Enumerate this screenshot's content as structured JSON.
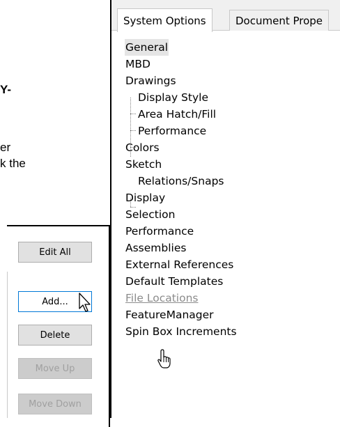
{
  "page_text": {
    "fragment_1": "Y-",
    "fragment_2": "er",
    "fragment_3": "k the"
  },
  "buttons": {
    "edit_all": "Edit All",
    "add": "Add...",
    "delete": "Delete",
    "move_up": "Move Up",
    "move_down": "Move Down"
  },
  "dialog": {
    "tabs": [
      "System Options",
      "Document Prope"
    ],
    "tree": [
      {
        "label": "General",
        "selected": true
      },
      {
        "label": "MBD"
      },
      {
        "label": "Drawings"
      },
      {
        "label": "Display Style",
        "child": true
      },
      {
        "label": "Area Hatch/Fill",
        "child": true
      },
      {
        "label": "Performance",
        "child": true
      },
      {
        "label": "Colors"
      },
      {
        "label": "Sketch"
      },
      {
        "label": "Relations/Snaps",
        "child": true
      },
      {
        "label": "Display"
      },
      {
        "label": "Selection"
      },
      {
        "label": "Performance"
      },
      {
        "label": "Assemblies"
      },
      {
        "label": "External References"
      },
      {
        "label": "Default Templates"
      },
      {
        "label": "File Locations",
        "hover": true
      },
      {
        "label": "FeatureManager"
      },
      {
        "label": "Spin Box Increments"
      }
    ]
  },
  "icons": {
    "arrow_cursor": "arrow-pointer-icon",
    "hand_cursor": "hand-pointer-icon"
  }
}
